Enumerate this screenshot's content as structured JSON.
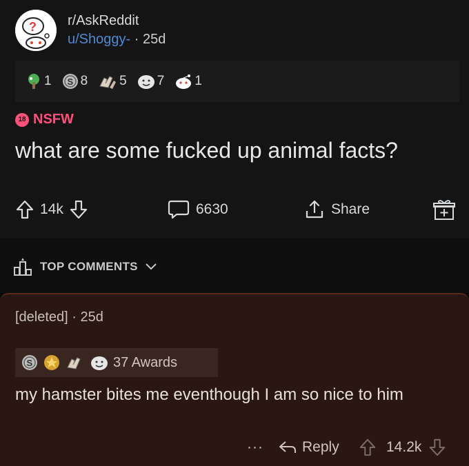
{
  "post": {
    "subreddit": "r/AskReddit",
    "author": "u/Shoggy-",
    "separator": "·",
    "age": "25d",
    "awards": [
      {
        "icon": "tree-award-icon",
        "count": "1"
      },
      {
        "icon": "silver-coin-icon",
        "count": "8"
      },
      {
        "icon": "hands-award-icon",
        "count": "5"
      },
      {
        "icon": "wholesome-award-icon",
        "count": "7"
      },
      {
        "icon": "snoo-award-icon",
        "count": "1"
      }
    ],
    "nsfw_badge": "18",
    "nsfw_label": "NSFW",
    "title": "what are some fucked up animal facts?",
    "upvotes": "14k",
    "comments": "6630",
    "share_label": "Share"
  },
  "sort": {
    "label": "TOP COMMENTS"
  },
  "comment": {
    "author": "[deleted]",
    "separator": "·",
    "age": "25d",
    "awards_label": "37 Awards",
    "body": "my hamster bites me eventhough I am so nice to him",
    "more": "···",
    "reply_label": "Reply",
    "score": "14.2k"
  },
  "colors": {
    "background": "#0b0b0b",
    "post_bg": "#141414",
    "comment_bg": "#2a1712",
    "nsfw": "#ff4f7a",
    "username": "#4f8ad6"
  }
}
